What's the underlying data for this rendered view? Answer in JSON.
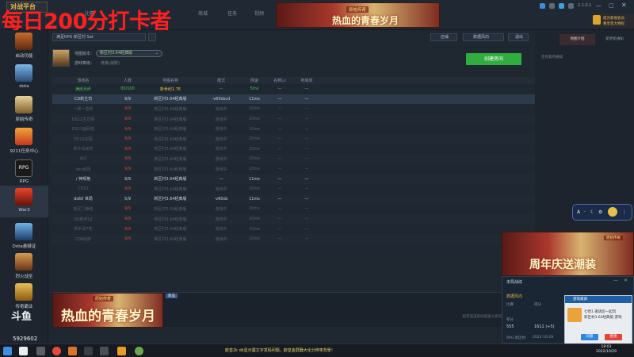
{
  "overlay": {
    "title": "每日200分打卡者"
  },
  "top": {
    "logo": "对战平台",
    "tabs": [
      "比赛",
      "商城",
      "任务",
      "视频"
    ],
    "ad_banner": {
      "headline": "热血的青春岁月",
      "sub": "原始传奇"
    },
    "version": "2.1.0.1",
    "promo": {
      "line1": "成为新视会员",
      "line2": "尊享百大特权"
    }
  },
  "sidebar": {
    "items": [
      {
        "label": "启动功能",
        "icon": "game-icon"
      },
      {
        "label": "dota",
        "icon": "dota-icon"
      },
      {
        "label": "原始传奇",
        "icon": "legend-icon"
      },
      {
        "label": "9211任务中心",
        "icon": "task-icon"
      },
      {
        "label": "RPG",
        "icon": "rpg-icon"
      },
      {
        "label": "War3",
        "icon": "war3-icon"
      },
      {
        "label": "Dota悬疑证",
        "icon": "dota2-icon"
      },
      {
        "label": "烈火战圣",
        "icon": "fire-icon"
      },
      {
        "label": "传奇霸业",
        "icon": "legend2-icon"
      }
    ],
    "bottom_logo": "斗鱼",
    "room_id": "5929602"
  },
  "main": {
    "channel_label": "满足RPG·新区村 Sat",
    "map_version_label": "地图版本：",
    "map_version_value": "新区村3.64经典版",
    "level_label": "游戏等级：",
    "level_value": "低级(战败)",
    "buttons": {
      "stats": "店铺",
      "data_analysis": "数据风向",
      "exit": "退出",
      "create_room": "创建房间"
    },
    "columns": [
      "游戏名",
      "人数",
      "地图名称",
      "模式",
      "网速",
      "名称Lv",
      "地域率"
    ],
    "rows": [
      {
        "name": "满房光纤",
        "count": "00/100",
        "map": "新世纪1.76",
        "mode": "—",
        "ping": "5ms",
        "lv": "—",
        "rate": "—",
        "style": "first"
      },
      {
        "name": "CD新主司",
        "count": "9/9",
        "map": "新区村3.64经典版",
        "mode": "-v60dscd",
        "ping": "11ms",
        "lv": "—",
        "rate": "—",
        "style": "bright hl"
      },
      {
        "name": "一换一造桥",
        "count": "9/9",
        "map": "新区村3.64经典版",
        "mode": "游戏中",
        "ping": "20ms",
        "lv": "—",
        "rate": "—",
        "style": ""
      },
      {
        "name": "DS12主司排",
        "count": "9/9",
        "map": "新区村3.64经典版",
        "mode": "游戏中",
        "ping": "20ms",
        "lv": "—",
        "rate": "—",
        "style": ""
      },
      {
        "name": "DS12面码结",
        "count": "9/9",
        "map": "新区村3.64经典版",
        "mode": "游戏中",
        "ping": "20ms",
        "lv": "—",
        "rate": "—",
        "style": ""
      },
      {
        "name": "DS12在码",
        "count": "9/9",
        "map": "新区村3.64经典版",
        "mode": "游戏中",
        "ping": "20ms",
        "lv": "—",
        "rate": "—",
        "style": ""
      },
      {
        "name": "新手请来开",
        "count": "9/9",
        "map": "新区村3.64经典版",
        "mode": "游戏中",
        "ping": "20ms",
        "lv": "—",
        "rate": "—",
        "style": ""
      },
      {
        "name": "ds2",
        "count": "9/9",
        "map": "新区村3.64经典版",
        "mode": "游戏中",
        "ping": "20ms",
        "lv": "—",
        "rate": "—",
        "style": ""
      },
      {
        "name": "dsc组排",
        "count": "9/9",
        "map": "新区村3.64经典版",
        "mode": "游戏中",
        "ping": "20ms",
        "lv": "—",
        "rate": "—",
        "style": ""
      },
      {
        "name": "/ 神规格",
        "count": "9/9",
        "map": "新区村3.64经典版",
        "mode": "—",
        "ping": "11ms",
        "lv": "—",
        "rate": "—",
        "style": "bright"
      },
      {
        "name": "CDS2",
        "count": "9/9",
        "map": "新区村3.64经典版",
        "mode": "游戏中",
        "ping": "20ms",
        "lv": "—",
        "rate": "—",
        "style": ""
      },
      {
        "name": "ds60 世局",
        "count": "5/9",
        "map": "新区村3.64经典版",
        "mode": "-v60ds",
        "ping": "11ms",
        "lv": "—",
        "rate": "—",
        "style": "bright"
      },
      {
        "name": "新区门神结",
        "count": "9/9",
        "map": "新区村3.64经典版",
        "mode": "游戏中",
        "ping": "20ms",
        "lv": "—",
        "rate": "—",
        "style": ""
      },
      {
        "name": "DS新手S2",
        "count": "9/9",
        "map": "新区村3.64经典版",
        "mode": "游戏中",
        "ping": "20ms",
        "lv": "—",
        "rate": "—",
        "style": ""
      },
      {
        "name": "新手请7吃",
        "count": "9/9",
        "map": "新区村3.64经典版",
        "mode": "游戏中",
        "ping": "20ms",
        "lv": "—",
        "rate": "—",
        "style": ""
      },
      {
        "name": "CD新组P",
        "count": "9/9",
        "map": "新区村3.64经典版",
        "mode": "游戏中",
        "ping": "20ms",
        "lv": "—",
        "rate": "—",
        "style": ""
      }
    ],
    "footer": {
      "badge": "新品",
      "hint": "您可双击房间名加入房间"
    }
  },
  "right": {
    "tabs": [
      "地图介绍",
      "新更新通知"
    ],
    "subtitle": "还有新的通知",
    "promo": {
      "headline": "周年庆送潮装",
      "sub": "原始传奇"
    },
    "room_panel": {
      "title": "本局战绩",
      "sub": "数据风向",
      "labels": [
        "比赛",
        "得分",
        "积分"
      ],
      "values": [
        "555",
        "1611 (+5)"
      ],
      "footer": "RPG·新区村",
      "date": "2022-10-29"
    }
  },
  "notify": {
    "title": "游戏邀请",
    "text_line1": "七哈1 邀请您一起玩",
    "text_line2": "新区村3.64经典版 游戏",
    "accept": "同意",
    "reject": "拒绝"
  },
  "taskbar": {
    "ticker": "欧皇2k  dk显示露文字发码问题，欧皇金屏器大化分辨率背景！",
    "time": "18:03",
    "date": "2022/10/29"
  }
}
